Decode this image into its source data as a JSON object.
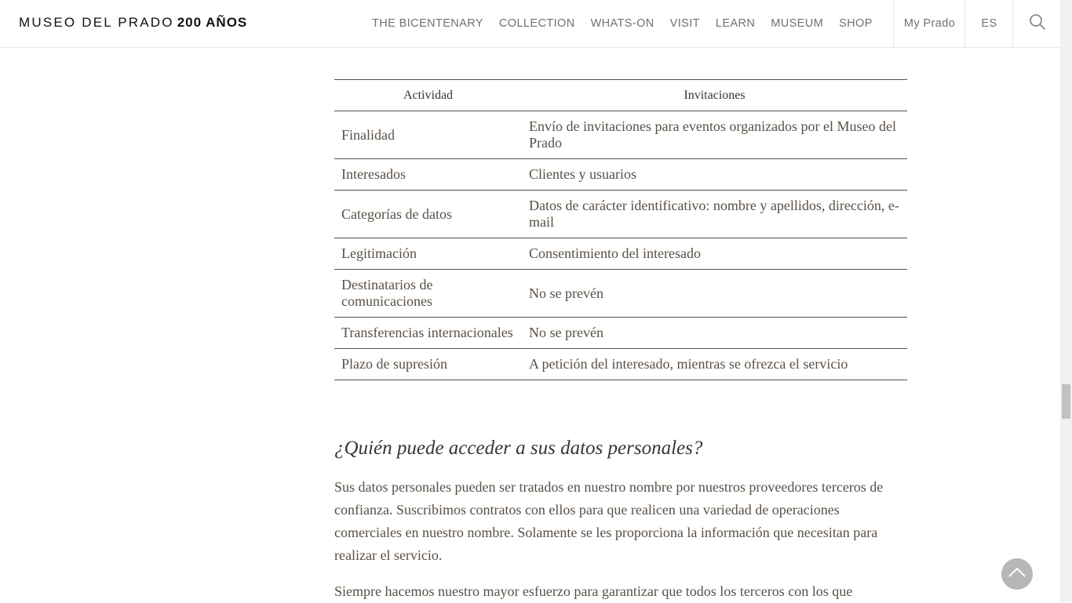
{
  "header": {
    "logo_text": "MUSEO DEL PRADO",
    "logo_years": "200 AÑOS",
    "nav": [
      "THE BICENTENARY",
      "COLLECTION",
      "WHATS-ON",
      "VISIT",
      "LEARN",
      "MUSEUM",
      "SHOP"
    ],
    "my_prado": "My Prado",
    "language": "ES",
    "search_icon": "search-icon"
  },
  "table": {
    "header": [
      "Actividad",
      "Invitaciones"
    ],
    "rows": [
      [
        "Finalidad",
        "Envío de invitaciones para eventos organizados por el Museo del Prado"
      ],
      [
        "Interesados",
        "Clientes y usuarios"
      ],
      [
        "Categorías de datos",
        "Datos de carácter identificativo: nombre y apellidos, dirección, e-mail"
      ],
      [
        "Legitimación",
        "Consentimiento del interesado"
      ],
      [
        "Destinatarios de comunicaciones",
        "No se prevén"
      ],
      [
        "Transferencias internacionales",
        "No se prevén"
      ],
      [
        "Plazo de supresión",
        "A petición del interesado, mientras se ofrezca el servicio"
      ]
    ]
  },
  "section": {
    "title": "¿Quién puede acceder a sus datos personales?",
    "paragraph1": "Sus datos personales pueden ser tratados en nuestro nombre por nuestros proveedores terceros de confianza. Suscribimos contratos con ellos para que realicen una variedad de operaciones comerciales en nuestro nombre. Solamente se les proporciona la información que necesitan para realizar el servicio.",
    "paragraph2": "Siempre hacemos nuestro mayor esfuerzo para garantizar que todos los terceros con los que"
  },
  "back_to_top_icon": "chevron-up-icon",
  "colors": {
    "text": "#5a5046",
    "heading": "#3a3530",
    "nav": "#707070",
    "rule": "#5a5046"
  }
}
